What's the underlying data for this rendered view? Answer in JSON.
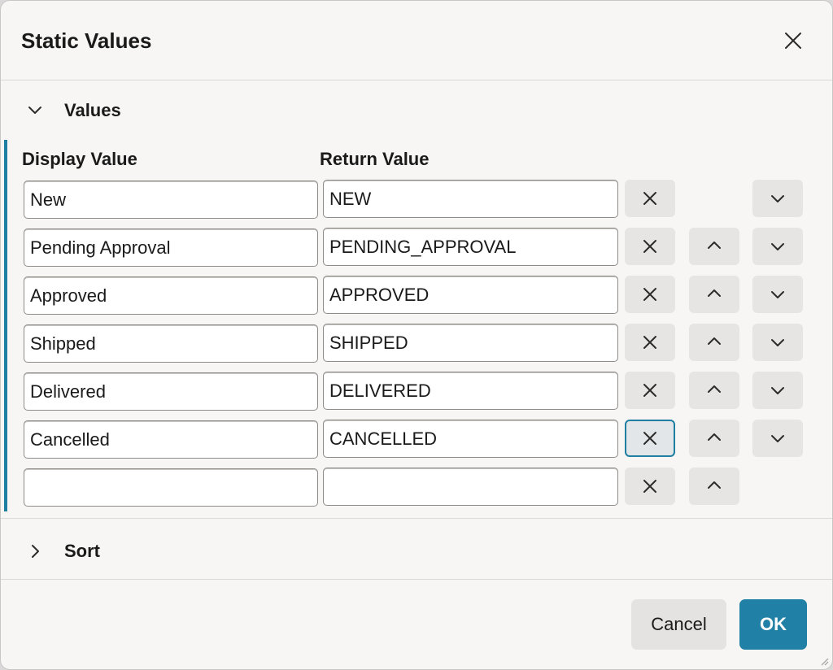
{
  "dialog": {
    "title": "Static Values",
    "close_icon": "close-icon"
  },
  "values_section": {
    "label": "Values",
    "expanded": true,
    "toggle_icon": "chevron-down-icon",
    "columns": {
      "display": "Display Value",
      "return": "Return Value"
    },
    "rows": [
      {
        "display": "New",
        "return": "NEW",
        "remove": true,
        "up": false,
        "down": true
      },
      {
        "display": "Pending Approval",
        "return": "PENDING_APPROVAL",
        "remove": true,
        "up": true,
        "down": true
      },
      {
        "display": "Approved",
        "return": "APPROVED",
        "remove": true,
        "up": true,
        "down": true
      },
      {
        "display": "Shipped",
        "return": "SHIPPED",
        "remove": true,
        "up": true,
        "down": true
      },
      {
        "display": "Delivered",
        "return": "DELIVERED",
        "remove": true,
        "up": true,
        "down": true
      },
      {
        "display": "Cancelled",
        "return": "CANCELLED",
        "remove": true,
        "up": true,
        "down": true,
        "remove_focused": true
      },
      {
        "display": "",
        "return": "",
        "remove": true,
        "up": true,
        "down": false
      }
    ],
    "accent_color": "#1f7fa3"
  },
  "sort_section": {
    "label": "Sort",
    "expanded": false,
    "toggle_icon": "chevron-right-icon"
  },
  "footer": {
    "cancel_label": "Cancel",
    "ok_label": "OK",
    "ok_color": "#2180a6"
  }
}
